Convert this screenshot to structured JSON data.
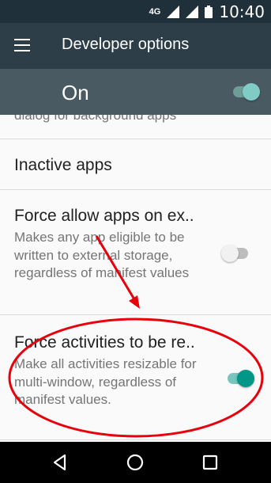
{
  "status_bar": {
    "network": "4G",
    "time": "10:40"
  },
  "app_bar": {
    "title": "Developer options",
    "menu_icon": "hamburger-menu-icon"
  },
  "master_switch": {
    "label": "On",
    "enabled": true
  },
  "settings": {
    "partial_summary": "dialog for background apps",
    "inactive_apps": {
      "title": "Inactive apps"
    },
    "force_external": {
      "title": "Force allow apps on ex..",
      "summary": "Makes any app eligible to be written to external storage, regardless of manifest values",
      "enabled": false
    },
    "force_resizable": {
      "title": "Force activities to be re..",
      "summary": "Make all activities resizable for multi-window, regardless of manifest values.",
      "enabled": true
    }
  },
  "nav_bar": {
    "back_icon": "back-icon",
    "home_icon": "home-icon",
    "recents_icon": "recents-icon"
  },
  "colors": {
    "accent": "#009688",
    "annotation": "#e8000b",
    "app_bar": "#2d3e48",
    "master_bar": "#4a5a62"
  }
}
